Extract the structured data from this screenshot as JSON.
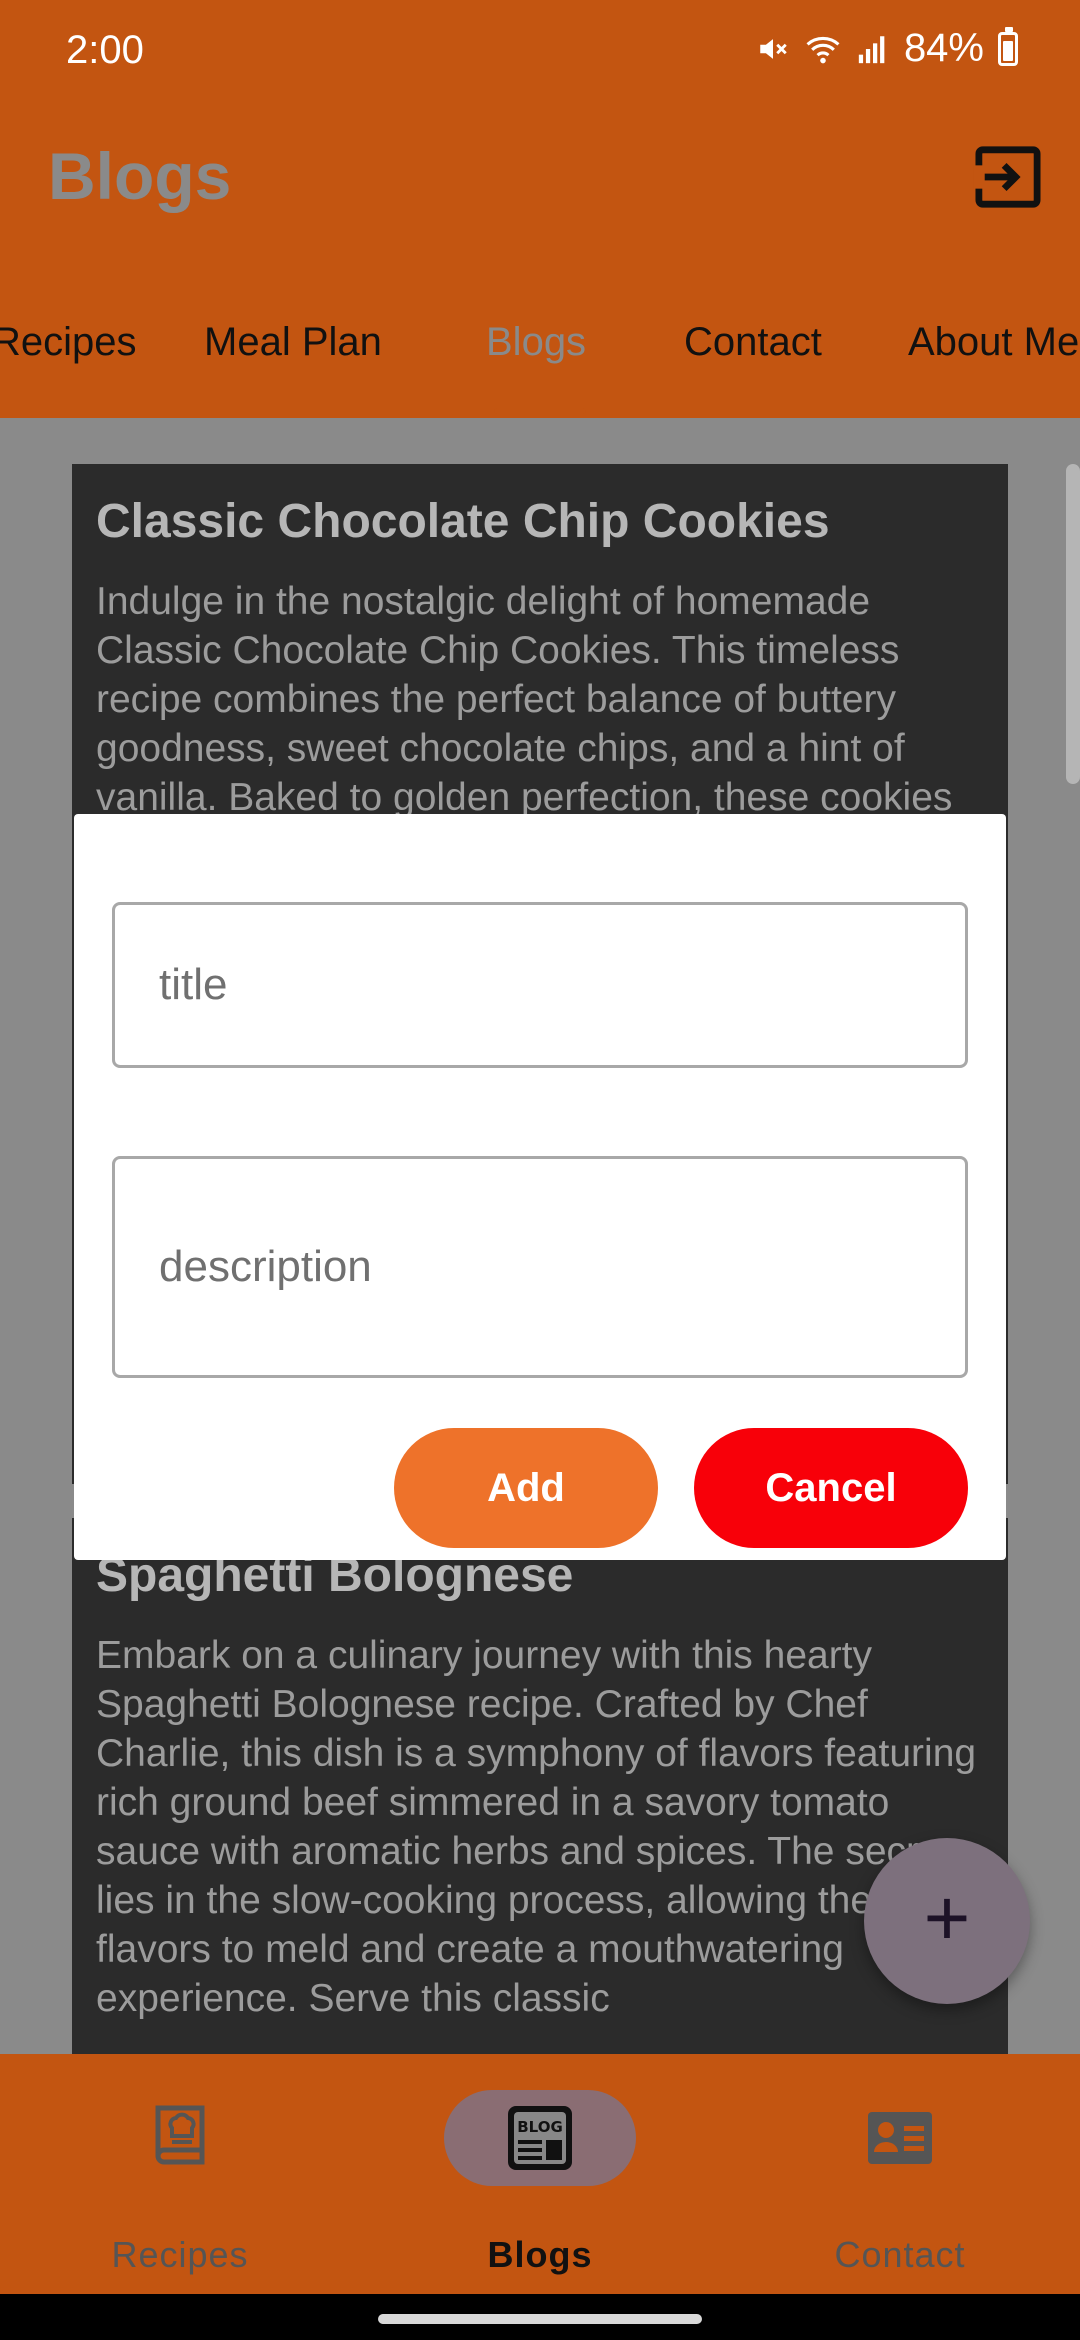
{
  "status_bar": {
    "time": "2:00",
    "battery": "84%"
  },
  "app_bar": {
    "title": "Blogs"
  },
  "tabs": [
    "Recipes",
    "Meal Plan",
    "Blogs",
    "Contact",
    "About Me"
  ],
  "cards": [
    {
      "title": "Classic Chocolate Chip Cookies",
      "description": "Indulge in the nostalgic delight of homemade Classic Chocolate Chip Cookies. This timeless recipe combines the perfect balance of buttery goodness, sweet chocolate chips, and a hint of vanilla. Baked to golden perfection, these cookies are a true classic."
    },
    {
      "title": "Spaghetti Bolognese",
      "description": "Embark on a culinary journey with this hearty Spaghetti Bolognese recipe. Crafted by Chef Charlie, this dish is a symphony of flavors featuring rich ground beef simmered in a savory tomato sauce with aromatic herbs and spices. The secret lies in the slow-cooking process, allowing the flavors to meld and create a mouthwatering experience. Serve this classic"
    }
  ],
  "dialog": {
    "title_placeholder": "title",
    "description_placeholder": "description",
    "add_label": "Add",
    "cancel_label": "Cancel"
  },
  "fab": {
    "icon": "+"
  },
  "bottom_nav": [
    {
      "label": "Recipes",
      "icon": "cookbook-icon",
      "active": false
    },
    {
      "label": "Blogs",
      "icon": "blog-icon",
      "active": true
    },
    {
      "label": "Contact",
      "icon": "contact-card-icon",
      "active": false
    }
  ],
  "colors": {
    "app_bar": "#c35511",
    "add_button": "#ee722a",
    "cancel_button": "#f80009"
  }
}
